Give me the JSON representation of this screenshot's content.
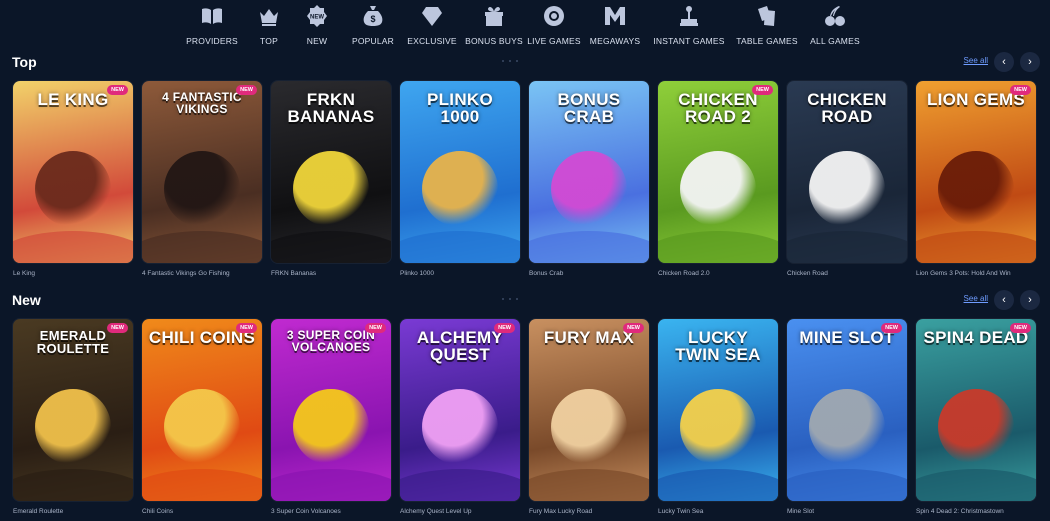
{
  "nav": {
    "categories": [
      {
        "label": "PROVIDERS",
        "icon": "book-icon"
      },
      {
        "label": "TOP",
        "icon": "crown-icon"
      },
      {
        "label": "NEW",
        "icon": "new-badge-icon"
      },
      {
        "label": "POPULAR",
        "icon": "money-bag-icon"
      },
      {
        "label": "EXCLUSIVE",
        "icon": "diamond-icon"
      },
      {
        "label": "BONUS BUYS",
        "icon": "gift-icon"
      },
      {
        "label": "LIVE GAMES",
        "icon": "chip-icon"
      },
      {
        "label": "MEGAWAYS",
        "icon": "megaways-m-icon"
      },
      {
        "label": "INSTANT GAMES",
        "icon": "joystick-icon"
      },
      {
        "label": "TABLE GAMES",
        "icon": "cards-icon"
      },
      {
        "label": "ALL GAMES",
        "icon": "cherries-icon"
      }
    ]
  },
  "sections": [
    {
      "title": "Top",
      "see_all": "See all",
      "games": [
        {
          "caption": "Le King",
          "art_title": "LE KING",
          "badge": "NEW",
          "colors": [
            "#f2d26a",
            "#d24a3a",
            "#6a2a1c"
          ]
        },
        {
          "caption": "4 Fantastic Vikings Go Fishing",
          "art_title": "4 FANTASTIC VIKINGS",
          "badge": "NEW",
          "colors": [
            "#8e5a3a",
            "#4a2e22",
            "#221614"
          ]
        },
        {
          "caption": "FRKN Bananas",
          "art_title": "FRKN BANANAS",
          "badge": "",
          "colors": [
            "#2a2a2e",
            "#101012",
            "#f0d53a"
          ]
        },
        {
          "caption": "Plinko 1000",
          "art_title": "PLINKO 1000",
          "badge": "",
          "colors": [
            "#3fa6f0",
            "#1f6fd0",
            "#e8b34a"
          ]
        },
        {
          "caption": "Bonus Crab",
          "art_title": "BONUS CRAB",
          "badge": "",
          "colors": [
            "#7ac4f4",
            "#4a70e0",
            "#d24ad4"
          ]
        },
        {
          "caption": "Chicken Road 2.0",
          "art_title": "CHICKEN ROAD 2",
          "badge": "NEW",
          "colors": [
            "#8fcf3a",
            "#5a9a20",
            "#f4f4f4"
          ]
        },
        {
          "caption": "Chicken Road",
          "art_title": "CHICKEN ROAD",
          "badge": "",
          "colors": [
            "#2a3a52",
            "#1a2638",
            "#f4f4f4"
          ]
        },
        {
          "caption": "Lion Gems 3 Pots: Hold And Win",
          "art_title": "LION GEMS",
          "badge": "NEW",
          "colors": [
            "#f0a030",
            "#c04a14",
            "#6a1c08"
          ]
        }
      ]
    },
    {
      "title": "New",
      "see_all": "See all",
      "games": [
        {
          "caption": "Emerald Roulette",
          "art_title": "EMERALD ROULETTE",
          "badge": "NEW",
          "colors": [
            "#4a3a22",
            "#2a1e14",
            "#f0c04a"
          ]
        },
        {
          "caption": "Chili Coins",
          "art_title": "CHILI COINS",
          "badge": "NEW",
          "colors": [
            "#f08a1a",
            "#e04a14",
            "#f4c84a"
          ]
        },
        {
          "caption": "3 Super Coin Volcanoes",
          "art_title": "3 SUPER COIN VOLCANOES",
          "badge": "NEW",
          "colors": [
            "#c02ad0",
            "#8a14b0",
            "#f4c81a"
          ]
        },
        {
          "caption": "Alchemy Quest Level Up",
          "art_title": "ALCHEMY QUEST",
          "badge": "NEW",
          "colors": [
            "#7a3ad4",
            "#3a1c8a",
            "#f0a0f4"
          ]
        },
        {
          "caption": "Fury Max Lucky Road",
          "art_title": "FURY MAX",
          "badge": "NEW",
          "colors": [
            "#c89060",
            "#7a4a2a",
            "#f0d0a0"
          ]
        },
        {
          "caption": "Lucky Twin Sea",
          "art_title": "LUCKY TWIN SEA",
          "badge": "",
          "colors": [
            "#3ab4f0",
            "#1a5ab0",
            "#f4d04a"
          ]
        },
        {
          "caption": "Mine Slot",
          "art_title": "MINE SLOT",
          "badge": "NEW",
          "colors": [
            "#4a90f0",
            "#2a60c0",
            "#a0a8b0"
          ]
        },
        {
          "caption": "Spin 4 Dead 2: Christmastown",
          "art_title": "SPIN4 DEAD",
          "badge": "NEW",
          "colors": [
            "#3aa0a0",
            "#1a5a6a",
            "#c83a2a"
          ]
        }
      ]
    }
  ]
}
